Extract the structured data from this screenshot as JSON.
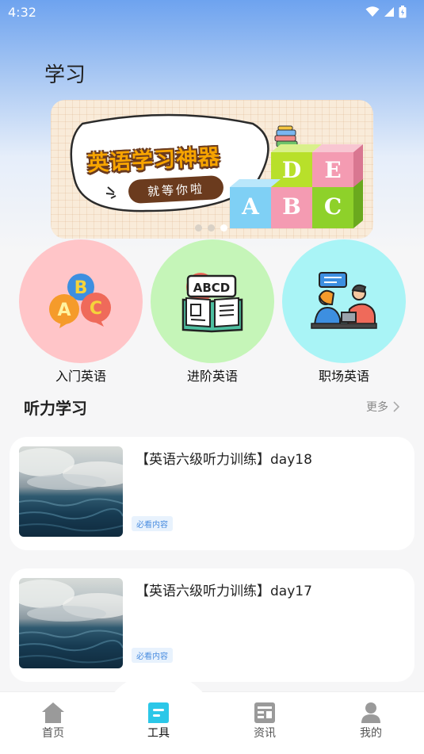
{
  "status_bar": {
    "time": "4:32"
  },
  "page_title": "学习",
  "banner": {
    "title": "英语学习神器",
    "subtitle": "就等你啦",
    "cube_letters": [
      "D",
      "E",
      "A",
      "B",
      "C"
    ],
    "page_count": 3,
    "active_page": 3
  },
  "categories": [
    {
      "label": "入门英语",
      "color": "#ffc5c8",
      "icon": "abc-balloons-icon"
    },
    {
      "label": "进阶英语",
      "color": "#c5f5b8",
      "icon": "abcd-book-icon"
    },
    {
      "label": "职场英语",
      "color": "#a9f4f6",
      "icon": "meeting-people-icon"
    }
  ],
  "section": {
    "title": "听力学习",
    "more_label": "更多"
  },
  "cards": [
    {
      "title": "【英语六级听力训练】day18",
      "tag": "必看内容"
    },
    {
      "title": "【英语六级听力训练】day17",
      "tag": "必看内容"
    }
  ],
  "nav": [
    {
      "label": "首页",
      "icon": "home-icon",
      "active": false
    },
    {
      "label": "工具",
      "icon": "tools-icon",
      "active": true
    },
    {
      "label": "资讯",
      "icon": "news-icon",
      "active": false
    },
    {
      "label": "我的",
      "icon": "profile-icon",
      "active": false
    }
  ],
  "colors": {
    "accent": "#2bc7e8",
    "tag_bg": "#e8f2fd",
    "tag_text": "#4a8de0"
  }
}
